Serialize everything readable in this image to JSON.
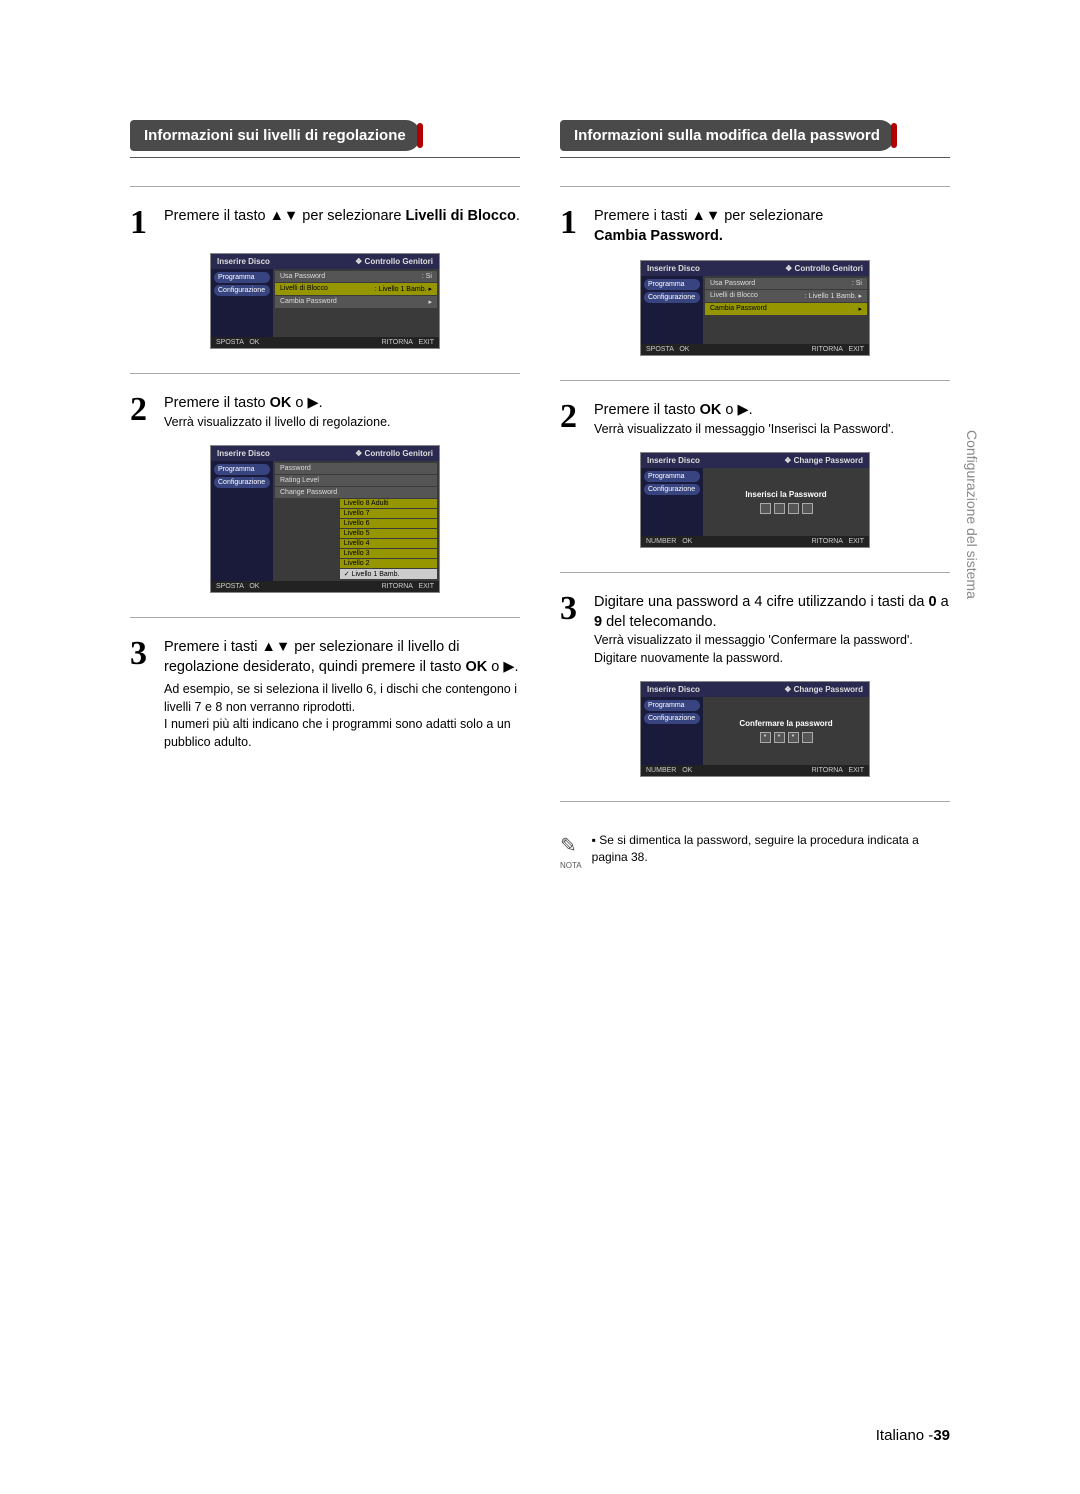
{
  "left_header": "Informazioni sui livelli di regolazione",
  "right_header": "Informazioni sulla modifica della password",
  "side_tab": "Configurazione del sistema",
  "left": {
    "s1": {
      "t1": "Premere il tasto ",
      "t2": " per selezionare ",
      "b1": "Livelli di Blocco",
      "t3": "."
    },
    "s2": {
      "t1": "Premere il tasto ",
      "b1": "OK",
      "t2": " o ▶.",
      "sub": "Verrà visualizzato il livello di regolazione."
    },
    "s3": {
      "t1": "Premere i tasti ",
      "t2": " per selezionare il livello di regolazione desiderato, quindi premere il tasto ",
      "b1": "OK",
      "t3": " o ▶.",
      "p1": "Ad esempio, se si seleziona il livello 6, i dischi che contengono i livelli 7 e 8 non verranno riprodotti.",
      "p2": "I numeri più alti indicano che i programmi sono adatti solo a un pubblico adulto."
    }
  },
  "right": {
    "s1": {
      "t1": "Premere i tasti ",
      "t2": " per selezionare ",
      "b1": "Cambia Password."
    },
    "s2": {
      "t1": "Premere il tasto ",
      "b1": "OK",
      "t2": " o ▶.",
      "sub": "Verrà visualizzato il messaggio 'Inserisci la Password'."
    },
    "s3": {
      "t1": "Digitare una password a 4 cifre utilizzando i tasti da ",
      "b1": "0",
      "t2": " a ",
      "b2": "9",
      "t3": " del telecomando.",
      "sub": "Verrà visualizzato il messaggio 'Confermare la password'. Digitare nuovamente la password."
    }
  },
  "note": {
    "label": "NOTA",
    "text": "Se si dimentica la password, seguire la procedura indicata a pagina 38."
  },
  "osd": {
    "title_insert": "Inserire Disco",
    "crumb_parent": "❖ Controllo Genitori",
    "crumb_change": "❖ Change Password",
    "side_prog": "Programma",
    "side_conf": "Configurazione",
    "row_usa": "Usa Password",
    "row_usa_val": ": Si",
    "row_livelli": "Livelli di Blocco",
    "row_livelli_val": ": Livello 1 Bamb. ▸",
    "row_cambia": "Cambia Password",
    "row_pw": "Password",
    "row_rating": "Rating Level",
    "row_changepw": "Change Password",
    "lv8": "Livello 8 Adulti",
    "lv7": "Livello 7",
    "lv6": "Livello 6",
    "lv5": "Livello 5",
    "lv4": "Livello 4",
    "lv3": "Livello 3",
    "lv2": "Livello 2",
    "lv1": "✓ Livello 1 Bamb.",
    "insert_pw": "Inserisci la Password",
    "confirm_pw": "Confermare la password",
    "foot_sposta": "SPOSTA",
    "foot_ok": "OK",
    "foot_ritorna": "RITORNA",
    "foot_exit": "EXIT",
    "foot_number": "NUMBER"
  },
  "footer_lang": "Italiano -",
  "footer_page": "39",
  "updown": "▲▼",
  "arrow": "▸",
  "bullet": "▪"
}
